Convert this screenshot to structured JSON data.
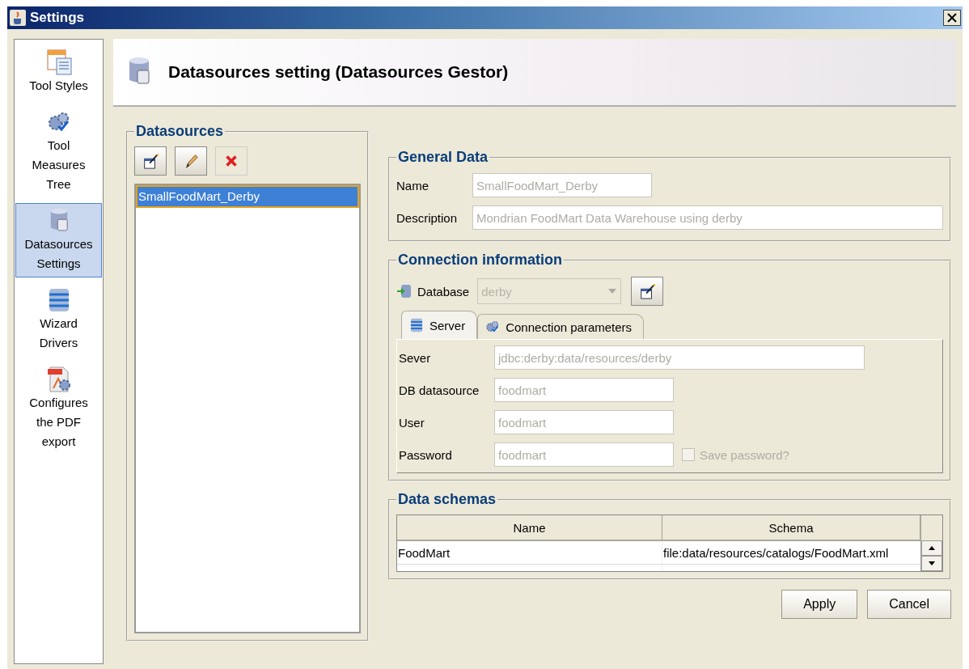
{
  "window": {
    "title": "Settings"
  },
  "sidebar": {
    "items": [
      {
        "label": "Tool Styles",
        "selected": false
      },
      {
        "label": "Tool Measures Tree",
        "selected": false
      },
      {
        "label": "Datasources Settings",
        "selected": true
      },
      {
        "label": "Wizard Drivers",
        "selected": false
      },
      {
        "label": "Configures the PDF export",
        "selected": false
      }
    ]
  },
  "header": {
    "title": "Datasources setting (Datasources Gestor)"
  },
  "datasources": {
    "title": "Datasources",
    "items": [
      {
        "label": "SmallFoodMart_Derby",
        "selected": true
      }
    ]
  },
  "general_data": {
    "title": "General Data",
    "fields": [
      {
        "label": "Name",
        "value": "SmallFoodMart_Derby",
        "disabled": true
      },
      {
        "label": "Description",
        "value": "Mondrian FoodMart Data Warehouse using derby",
        "disabled": true
      }
    ]
  },
  "connection": {
    "title": "Connection information",
    "database": {
      "label": "Database",
      "value": "derby",
      "disabled": true
    },
    "tabs": [
      {
        "label": "Server",
        "selected": true
      },
      {
        "label": "Connection parameters",
        "selected": false
      }
    ],
    "fields": [
      {
        "label": "Sever",
        "value": "jdbc:derby:data/resources/derby",
        "disabled": true
      },
      {
        "label": "DB datasource",
        "value": "foodmart",
        "disabled": true
      },
      {
        "label": "User",
        "value": "foodmart",
        "disabled": true
      },
      {
        "label": "Password",
        "value": "foodmart",
        "disabled": true
      }
    ],
    "save_password": {
      "label": "Save password?",
      "checked": false,
      "disabled": true
    }
  },
  "data_schemas": {
    "title": "Data schemas",
    "columns": [
      "Name",
      "Schema"
    ],
    "rows": [
      [
        "FoodMart",
        "file:data/resources/catalogs/FoodMart.xml"
      ]
    ]
  },
  "buttons": [
    "Apply",
    "Cancel"
  ]
}
